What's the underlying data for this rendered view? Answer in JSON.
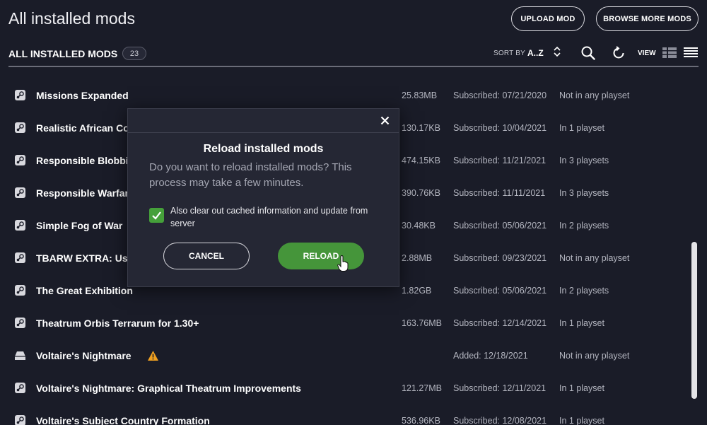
{
  "header": {
    "title": "All installed mods",
    "upload_label": "UPLOAD MOD",
    "browse_label": "BROWSE MORE MODS"
  },
  "subheader": {
    "title": "ALL INSTALLED MODS",
    "count": "23",
    "sort_label": "SORT BY",
    "sort_value": "A..Z",
    "view_label": "VIEW"
  },
  "mods": [
    {
      "name": "Missions Expanded",
      "size": "25.83MB",
      "date": "Subscribed: 07/21/2020",
      "playset": "Not in any playset",
      "icon": "steam-icon"
    },
    {
      "name": "Realistic African Co",
      "size": "130.17KB",
      "date": "Subscribed: 10/04/2021",
      "playset": "In 1 playset",
      "icon": "steam-icon"
    },
    {
      "name": "Responsible Blobbi",
      "size": "474.15KB",
      "date": "Subscribed: 11/21/2021",
      "playset": "In 3 playsets",
      "icon": "steam-icon"
    },
    {
      "name": "Responsible Warfar",
      "size": "390.76KB",
      "date": "Subscribed: 11/11/2021",
      "playset": "In 3 playsets",
      "icon": "steam-icon"
    },
    {
      "name": "Simple Fog of War",
      "size": "30.48KB",
      "date": "Subscribed: 05/06/2021",
      "playset": "In 2 playsets",
      "icon": "steam-icon"
    },
    {
      "name": "TBARW EXTRA: Use",
      "size": "2.88MB",
      "date": "Subscribed: 09/23/2021",
      "playset": "Not in any playset",
      "icon": "steam-icon"
    },
    {
      "name": "The Great Exhibition",
      "size": "1.82GB",
      "date": "Subscribed: 05/06/2021",
      "playset": "In 2 playsets",
      "icon": "steam-icon"
    },
    {
      "name": "Theatrum Orbis Terrarum for 1.30+",
      "size": "163.76MB",
      "date": "Subscribed: 12/14/2021",
      "playset": "In 1 playset",
      "icon": "steam-icon"
    },
    {
      "name": "Voltaire's Nightmare",
      "size": "",
      "date": "Added: 12/18/2021",
      "playset": "Not in any playset",
      "icon": "local-drive-icon",
      "warning": true
    },
    {
      "name": "Voltaire's Nightmare: Graphical Theatrum Improvements",
      "size": "121.27MB",
      "date": "Subscribed: 12/11/2021",
      "playset": "In 1 playset",
      "icon": "steam-icon"
    },
    {
      "name": "Voltaire's Subject Country Formation",
      "size": "536.96KB",
      "date": "Subscribed: 12/08/2021",
      "playset": "In 1 playset",
      "icon": "steam-icon"
    }
  ],
  "modal": {
    "title": "Reload installed mods",
    "body": "Do you want to reload installed mods? This process may take a few minutes.",
    "checkbox_label": "Also clear out cached information and update from server",
    "checkbox_checked": true,
    "cancel_label": "CANCEL",
    "reload_label": "RELOAD"
  },
  "colors": {
    "background": "#1a1c28",
    "modal_bg": "#252734",
    "accent_green": "#45953a",
    "warning": "#f0a020"
  }
}
